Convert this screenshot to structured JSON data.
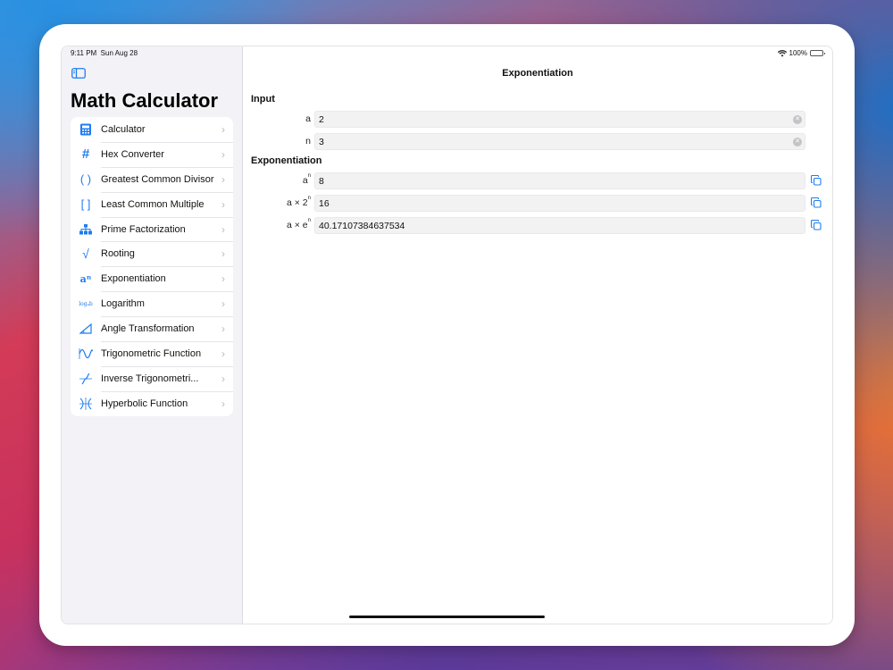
{
  "status_bar": {
    "time": "9:11 PM",
    "date": "Sun Aug 28",
    "battery": "100%"
  },
  "sidebar": {
    "title": "Math Calculator",
    "items": [
      {
        "label": "Calculator",
        "icon": "calculator-icon"
      },
      {
        "label": "Hex Converter",
        "icon": "hash-icon"
      },
      {
        "label": "Greatest Common Divisor",
        "icon": "parentheses-icon"
      },
      {
        "label": "Least Common Multiple",
        "icon": "brackets-icon"
      },
      {
        "label": "Prime Factorization",
        "icon": "tree-icon"
      },
      {
        "label": "Rooting",
        "icon": "square-root-icon"
      },
      {
        "label": "Exponentiation",
        "icon": "exponent-icon",
        "glyph": "aⁿ"
      },
      {
        "label": "Logarithm",
        "icon": "log-icon",
        "glyph": "logₐb"
      },
      {
        "label": "Angle Transformation",
        "icon": "angle-icon"
      },
      {
        "label": "Trigonometric Function",
        "icon": "wave-icon"
      },
      {
        "label": "Inverse Trigonometri...",
        "icon": "inverse-wave-icon"
      },
      {
        "label": "Hyperbolic Function",
        "icon": "hyperbolic-icon"
      }
    ]
  },
  "main": {
    "title": "Exponentiation",
    "input_section": "Input",
    "inputs": [
      {
        "label": "a",
        "value": "2"
      },
      {
        "label": "n",
        "value": "3"
      }
    ],
    "result_section": "Exponentiation",
    "results": [
      {
        "label_base": "a",
        "label_sup": "n",
        "value": "8"
      },
      {
        "label_base": "a × 2",
        "label_sup": "n",
        "value": "16"
      },
      {
        "label_base": "a × e",
        "label_sup": "n",
        "value": "40.17107384637534"
      }
    ]
  },
  "colors": {
    "accent": "#1e7cf2",
    "sidebar_bg": "#f2f2f7"
  }
}
